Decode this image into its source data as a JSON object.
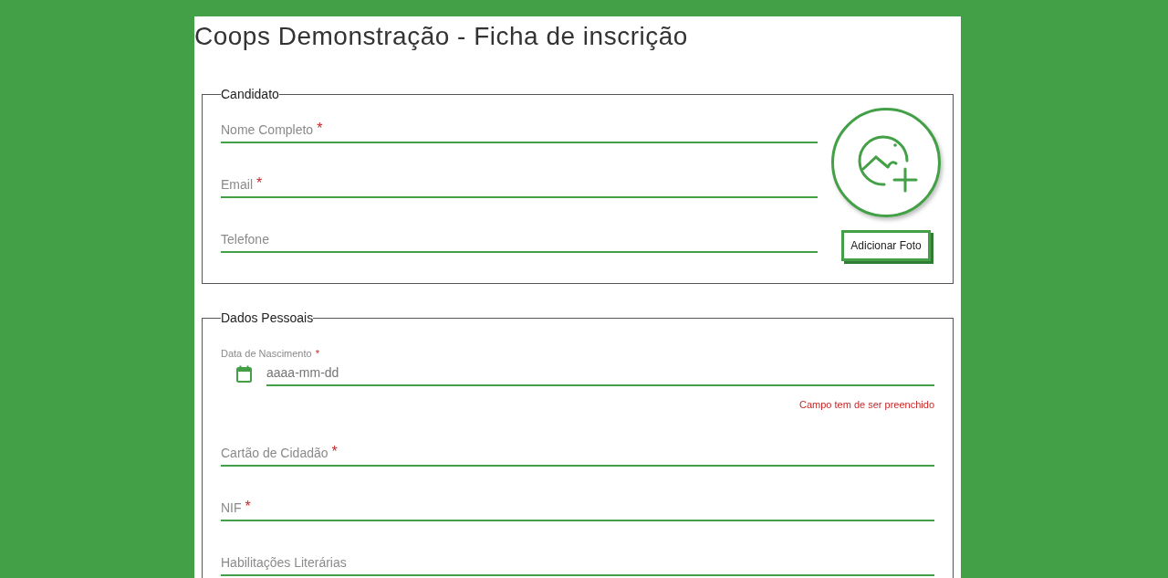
{
  "title": "Coops Demonstração - Ficha de inscrição",
  "sections": [
    {
      "legend": "Candidato",
      "fields": [
        {
          "kind": "text",
          "label": "Nome Completo",
          "marker": "*"
        },
        {
          "kind": "text",
          "label": "Email",
          "marker": "*"
        },
        {
          "kind": "text",
          "label": "Telefone"
        }
      ],
      "photo": {
        "button": "Adicionar Foto"
      }
    },
    {
      "legend": "Dados Pessoais",
      "fields": [
        {
          "kind": "date",
          "label": "Data de Nascimento",
          "marker": "*",
          "placeholder": "aaaa-mm-dd",
          "error": "Campo tem de ser preenchido"
        },
        {
          "kind": "text",
          "label": "Cartão de Cidadão",
          "marker": "*"
        },
        {
          "kind": "text",
          "label": "NIF",
          "marker": "*"
        },
        {
          "kind": "text",
          "label": "Habilitações Literárias"
        }
      ]
    }
  ]
}
